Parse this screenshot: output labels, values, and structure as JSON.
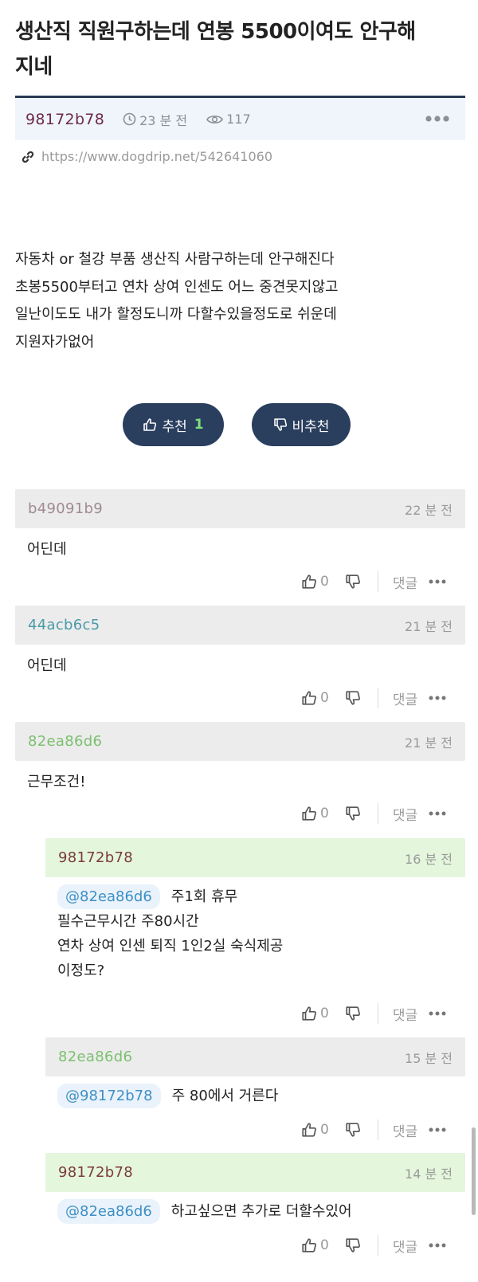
{
  "post": {
    "title_line1": "생산직 직원구하는데 연봉 5500이여도 안구해",
    "title_line2": "지네",
    "author": "98172b78",
    "time": "23 분 전",
    "views": "117",
    "url": "https://www.dogdrip.net/542641060",
    "body": [
      "자동차 or 철강 부품 생산직 사람구하는데 안구해진다",
      "초봉5500부터고 연차 상여 인센도 어느 중견못지않고",
      "일난이도도 내가 할정도니까 다할수있을정도로 쉬운데",
      "지원자가없어"
    ],
    "upvote_label": "추천",
    "upvote_count": "1",
    "downvote_label": "비추천"
  },
  "comments": [
    {
      "author": "b49091b9",
      "time": "22 분 전",
      "lines": [
        "어딘데"
      ],
      "likes": "0",
      "reply_label": "댓글"
    },
    {
      "author": "44acb6c5",
      "time": "21 분 전",
      "lines": [
        "어딘데"
      ],
      "likes": "0",
      "reply_label": "댓글"
    },
    {
      "author": "82ea86d6",
      "time": "21 분 전",
      "lines": [
        "근무조건!"
      ],
      "likes": "0",
      "reply_label": "댓글"
    },
    {
      "author": "98172b78",
      "time": "16 분 전",
      "mention": "@82ea86d6",
      "lines": [
        "주1회 휴무",
        "필수근무시간 주80시간",
        "연차 상여 인센 퇴직 1인2실 숙식제공",
        "이정도?"
      ],
      "likes": "0",
      "reply_label": "댓글"
    },
    {
      "author": "82ea86d6",
      "time": "15 분 전",
      "mention": "@98172b78",
      "lines": [
        "주 80에서 거른다"
      ],
      "likes": "0",
      "reply_label": "댓글"
    },
    {
      "author": "98172b78",
      "time": "14 분 전",
      "mention": "@82ea86d6",
      "lines": [
        "하고싶으면 추가로 더할수있어"
      ],
      "likes": "0",
      "reply_label": "댓글"
    }
  ],
  "colors": {
    "accent_navy": "#2a3e5e",
    "author_post": "#6e2b4b",
    "author_b49091b9": "#a08a92",
    "author_44acb6c5": "#4c9aa8",
    "author_82ea86d6": "#7cc070",
    "author_98172b78": "#7b3b3b",
    "reply_header_bg": "#e4f6dc",
    "comment_header_bg": "#ececec"
  },
  "icons": [
    "clock-icon",
    "eye-icon",
    "more-dots-icon",
    "link-icon",
    "thumbs-up-icon",
    "thumbs-down-icon"
  ]
}
